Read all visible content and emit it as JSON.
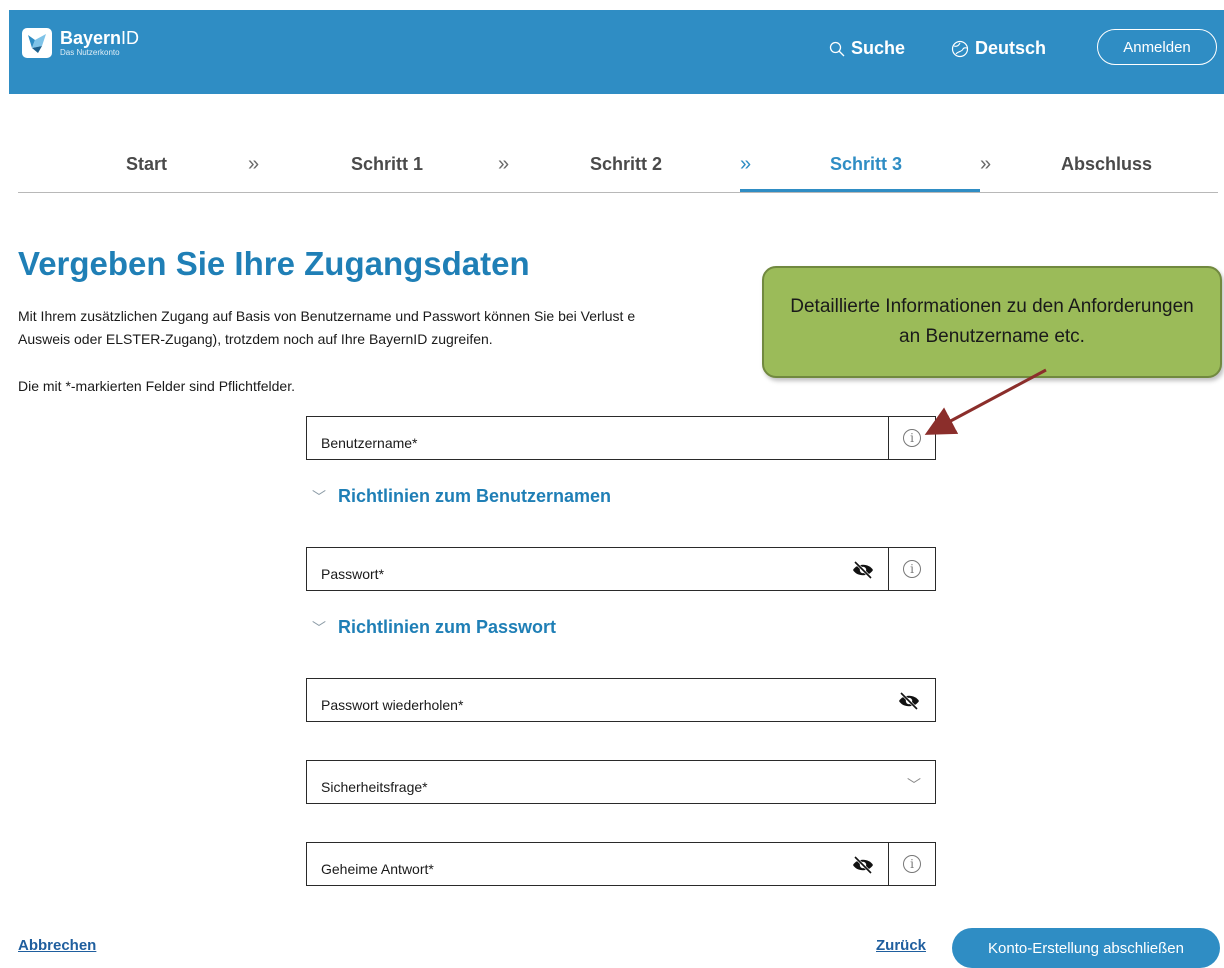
{
  "header": {
    "logo_name_bold": "Bayern",
    "logo_name_thin": "ID",
    "logo_subtitle": "Das Nutzerkonto",
    "search_label": "Suche",
    "language_label": "Deutsch",
    "login_label": "Anmelden",
    "background_color": "#2f8dc4"
  },
  "stepper": {
    "steps": [
      "Start",
      "Schritt 1",
      "Schritt 2",
      "Schritt 3",
      "Abschluss"
    ],
    "separator": "»",
    "active_step": "Schritt 3"
  },
  "page": {
    "title": "Vergeben Sie Ihre Zugangsdaten",
    "intro_line1": "Mit Ihrem zusätzlichen Zugang auf Basis von Benutzername und Passwort können Sie bei Verlust e",
    "intro_line2": "Ausweis oder ELSTER-Zugang), trotzdem noch auf Ihre BayernID zugreifen.",
    "required_note": "Die mit *-markierten Felder sind Pflichtfelder."
  },
  "form": {
    "username_label": "Benutzername*",
    "username_guidelines": "Richtlinien zum Benutzernamen",
    "password_label": "Passwort*",
    "password_guidelines": "Richtlinien zum Passwort",
    "password_repeat_label": "Passwort wiederholen*",
    "security_question_label": "Sicherheitsfrage*",
    "secret_answer_label": "Geheime Antwort*"
  },
  "callout": {
    "text": "Detaillierte Informationen zu den Anforderungen an Benutzername etc."
  },
  "footer": {
    "cancel_label": "Abbrechen",
    "back_label": "Zurück",
    "submit_label": "Konto-Erstellung abschließen"
  }
}
